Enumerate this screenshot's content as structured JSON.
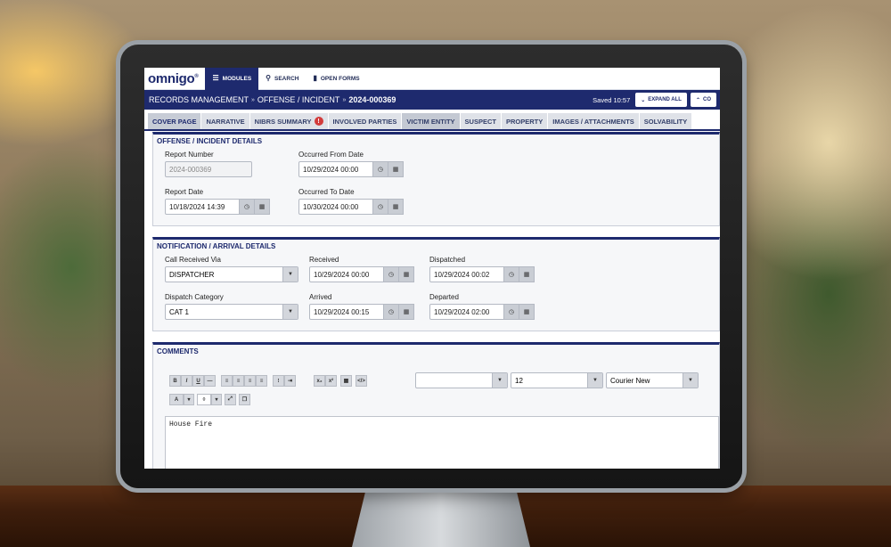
{
  "app": {
    "logo": "omnigo",
    "logo_mark": "®"
  },
  "nav": {
    "modules": "MODULES",
    "search": "SEARCH",
    "open_forms": "OPEN FORMS"
  },
  "breadcrumb": {
    "part1": "RECORDS MANAGEMENT",
    "part2": "OFFENSE / INCIDENT",
    "record": "2024-000369",
    "sep": "»"
  },
  "toolbar": {
    "saved": "Saved 10:57",
    "expand_all": "EXPAND ALL",
    "collapse": "CO"
  },
  "tabs": [
    {
      "label": "COVER PAGE"
    },
    {
      "label": "NARRATIVE"
    },
    {
      "label": "NIBRS SUMMARY"
    },
    {
      "label": "INVOLVED PARTIES"
    },
    {
      "label": "VICTIM ENTITY"
    },
    {
      "label": "SUSPECT"
    },
    {
      "label": "PROPERTY"
    },
    {
      "label": "IMAGES / ATTACHMENTS"
    },
    {
      "label": "SOLVABILITY"
    }
  ],
  "offense": {
    "title": "OFFENSE / INCIDENT DETAILS",
    "report_number_label": "Report Number",
    "report_number": "2024-000369",
    "occurred_from_label": "Occurred From Date",
    "occurred_from": "10/29/2024 00:00",
    "report_date_label": "Report Date",
    "report_date": "10/18/2024 14:39",
    "occurred_to_label": "Occurred To Date",
    "occurred_to": "10/30/2024 00:00"
  },
  "notification": {
    "title": "NOTIFICATION / ARRIVAL DETAILS",
    "call_received_label": "Call Received Via",
    "call_received": "DISPATCHER",
    "received_label": "Received",
    "received": "10/29/2024 00:00",
    "dispatched_label": "Dispatched",
    "dispatched": "10/29/2024 00:02",
    "dispatch_category_label": "Dispatch Category",
    "dispatch_category": "CAT 1",
    "arrived_label": "Arrived",
    "arrived": "10/29/2024 00:15",
    "departed_label": "Departed",
    "departed": "10/29/2024 02:00"
  },
  "comments": {
    "title": "COMMENTS",
    "font_size": "12",
    "font_family": "Courier New",
    "text": "House Fire"
  }
}
